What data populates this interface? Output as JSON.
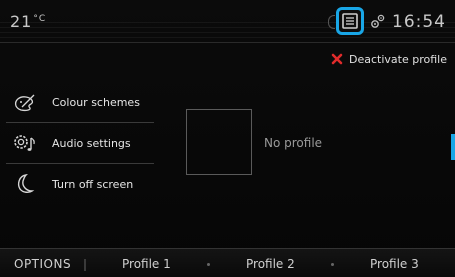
{
  "status": {
    "temperature": "21",
    "temperature_unit": "°C",
    "time": "16:54"
  },
  "header": {
    "deactivate_label": "Deactivate profile"
  },
  "menu": {
    "items": [
      {
        "label": "Colour schemes",
        "icon": "palette-icon"
      },
      {
        "label": "Audio settings",
        "icon": "audio-settings-icon"
      },
      {
        "label": "Turn off screen",
        "icon": "moon-icon"
      }
    ]
  },
  "profile": {
    "status_text": "No profile"
  },
  "tabs": {
    "options": "OPTIONS",
    "profile1": "Profile 1",
    "profile2": "Profile 2",
    "profile3": "Profile 3"
  },
  "colors": {
    "accent": "#19a6e6",
    "delete": "#e02b2b",
    "background": "#000000"
  }
}
